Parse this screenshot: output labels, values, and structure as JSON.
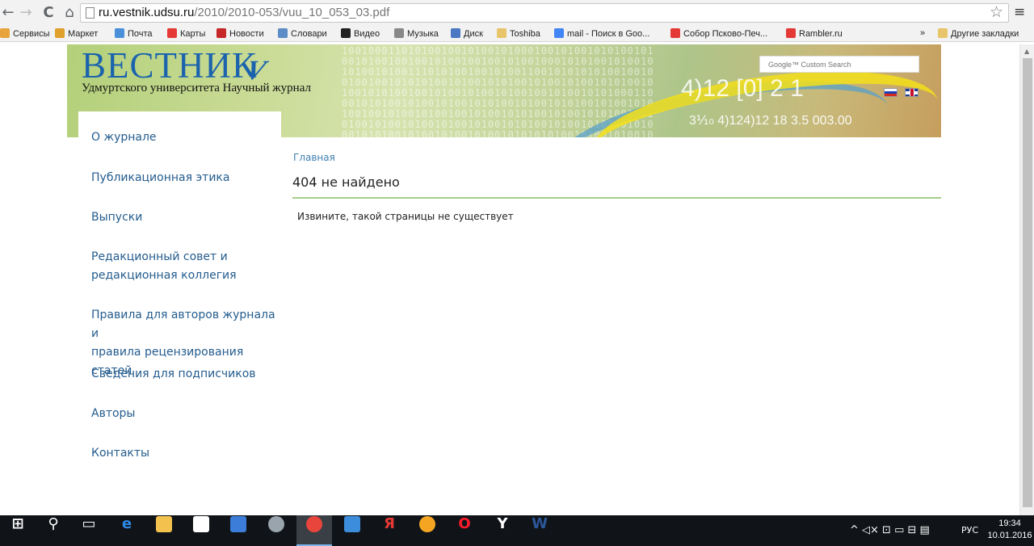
{
  "browser": {
    "url_domain": "ru.vestnik.udsu.ru",
    "url_path": "/2010/2010-053/vuu_10_053_03.pdf",
    "back_glyph": "←",
    "forward_glyph": "→",
    "reload_glyph": "C",
    "home_glyph": "⌂",
    "star_glyph": "☆",
    "menu_glyph": "≡",
    "bookmarks": [
      {
        "label": "Сервисы",
        "icon": "apps-icon",
        "color": "#e8a33d"
      },
      {
        "label": "Маркет",
        "icon": "market-icon",
        "color": "#e0a02c"
      },
      {
        "label": "Почта",
        "icon": "mail-icon",
        "color": "#4a90d9"
      },
      {
        "label": "Карты",
        "icon": "map-pin-icon",
        "color": "#e53935"
      },
      {
        "label": "Новости",
        "icon": "news-icon",
        "color": "#c62828"
      },
      {
        "label": "Словари",
        "icon": "dictionary-icon",
        "color": "#5c8dc7"
      },
      {
        "label": "Видео",
        "icon": "video-icon",
        "color": "#222222"
      },
      {
        "label": "Музыка",
        "icon": "music-icon",
        "color": "#888888"
      },
      {
        "label": "Диск",
        "icon": "disk-icon",
        "color": "#4a78c2"
      },
      {
        "label": "Toshiba",
        "icon": "folder-icon",
        "color": "#e8c46a"
      },
      {
        "label": "mail - Поиск в Goo...",
        "icon": "google-icon",
        "color": "#4285f4"
      },
      {
        "label": "Собор Псково-Печ...",
        "icon": "yandex-icon",
        "color": "#e53935"
      },
      {
        "label": "Rambler.ru",
        "icon": "yandex-icon",
        "color": "#e53935"
      }
    ],
    "more_bookmarks": "»",
    "other_bookmarks": "Другие закладки"
  },
  "header": {
    "title": "ВЕСТНИК",
    "logo_mark": "V",
    "subtitle": "Удмуртского университета Научный журнал",
    "search_placeholder": "Google™ Custom Search",
    "banner_nums": "4)12 [0]  2  1",
    "banner_nums2": "3⅒  4)124)12   18 3.5  003.00",
    "lang_ru": "Русский",
    "lang_en": "English"
  },
  "sidebar": {
    "items": [
      {
        "label": "О журнале"
      },
      {
        "label": "Публикационная этика"
      },
      {
        "label": "Выпуски"
      },
      {
        "label": "Редакционный совет и\nредакционная коллегия"
      },
      {
        "label": "Правила для авторов журнала и\nправила рецензирования статей"
      },
      {
        "label": "Сведения для подписчиков"
      },
      {
        "label": "Авторы"
      },
      {
        "label": "Контакты"
      }
    ]
  },
  "main": {
    "breadcrumb": "Главная",
    "heading": "404 не найдено",
    "message": "Извините, такой страницы не существует"
  },
  "taskbar": {
    "apps": [
      {
        "name": "start-button",
        "glyph": "⊞",
        "color": "#ffffff"
      },
      {
        "name": "search-icon",
        "glyph": "⚲",
        "color": "#ffffff"
      },
      {
        "name": "task-view-icon",
        "glyph": "▭",
        "color": "#ffffff"
      },
      {
        "name": "edge-icon",
        "glyph": "e",
        "color": "#2c8ae8"
      },
      {
        "name": "file-explorer-icon",
        "glyph": "",
        "color": "#f2c14e"
      },
      {
        "name": "store-icon",
        "glyph": "",
        "color": "#ffffff"
      },
      {
        "name": "media-player-icon",
        "glyph": "",
        "color": "#3b7dd8"
      },
      {
        "name": "app-circle-icon",
        "glyph": "",
        "color": "#9aa4ad"
      },
      {
        "name": "chrome-icon",
        "glyph": "",
        "color": "#e8453c"
      },
      {
        "name": "mail-app-icon",
        "glyph": "",
        "color": "#3c8ddb"
      },
      {
        "name": "yandex-app-icon",
        "glyph": "Я",
        "color": "#e53935"
      },
      {
        "name": "weather-icon",
        "glyph": "",
        "color": "#f4a623"
      },
      {
        "name": "opera-icon",
        "glyph": "O",
        "color": "#ff1b2d"
      },
      {
        "name": "yandex-browser-icon",
        "glyph": "Y",
        "color": "#ffffff"
      },
      {
        "name": "word-icon",
        "glyph": "W",
        "color": "#2b579a"
      }
    ],
    "tray_glyphs": "^ ◁× ⊡ ▭ ⊟ ▤",
    "language": "РУС",
    "time": "19:34",
    "date": "10.01.2016"
  }
}
